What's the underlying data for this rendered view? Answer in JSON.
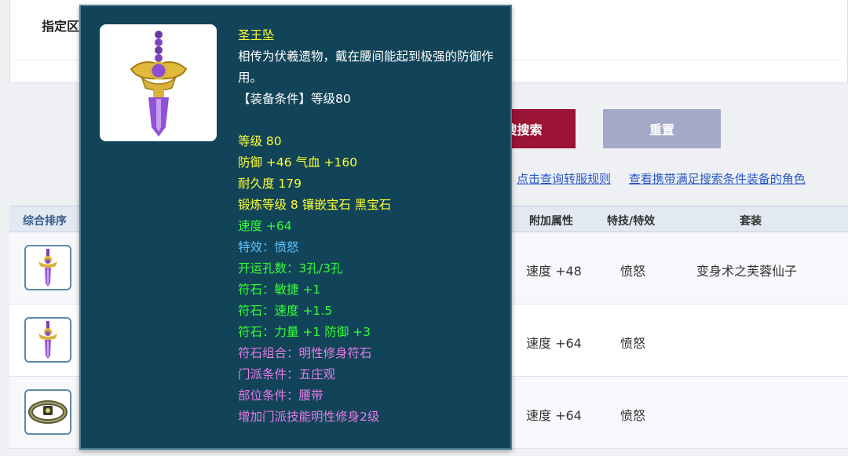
{
  "filter": {
    "label": "指定区"
  },
  "buttons": {
    "search_label": "搜搜索",
    "reset_label": "重置"
  },
  "links": {
    "rules": "点击查询转服规则",
    "check_chars": "查看携带满足搜索条件装备的角色"
  },
  "table": {
    "headers": {
      "sort": "综合排序",
      "attr": "附加属性",
      "skill": "特技/特效",
      "set": "套装"
    },
    "rows": [
      {
        "attr": "速度 +48",
        "skill": "愤怒",
        "set": "变身术之芙蓉仙子",
        "icon": "purple-sword-pendant-icon"
      },
      {
        "attr": "速度 +64",
        "skill": "愤怒",
        "set": "",
        "icon": "purple-sword-pendant-icon"
      },
      {
        "attr": "速度 +64",
        "skill": "愤怒",
        "set": "",
        "icon": "belt-icon"
      }
    ]
  },
  "tooltip": {
    "name": "圣王坠",
    "description": "相传为伏羲遗物，戴在腰间能起到极强的防御作用。",
    "requirement": "【装备条件】等级80",
    "level": "等级 80",
    "defense": "防御 +46 气血 +160",
    "durability": "耐久度 179",
    "forge": "锻炼等级 8 镶嵌宝石 黑宝石",
    "speed": "速度 +64",
    "effect": "特效：愤怒",
    "holes": "开运孔数：3孔/3孔",
    "rune1": "符石：敏捷 +1",
    "rune2": "符石：速度 +1.5",
    "rune3": "符石：力量 +1 防御 +3",
    "rune_combo": "符石组合：明性修身符石",
    "school": "门派条件：五庄观",
    "slot": "部位条件：腰带",
    "bonus": "增加门派技能明性修身2级"
  },
  "colors": {
    "tooltip_bg": "#114458",
    "name_yellow": "#ffff33",
    "stat_green": "#33ff33",
    "effect_blue": "#5fc2ff",
    "rune_pink": "#e87ae8",
    "search_button": "#9b1335",
    "reset_button": "#a5a9c8",
    "link_blue": "#2a57c8"
  }
}
